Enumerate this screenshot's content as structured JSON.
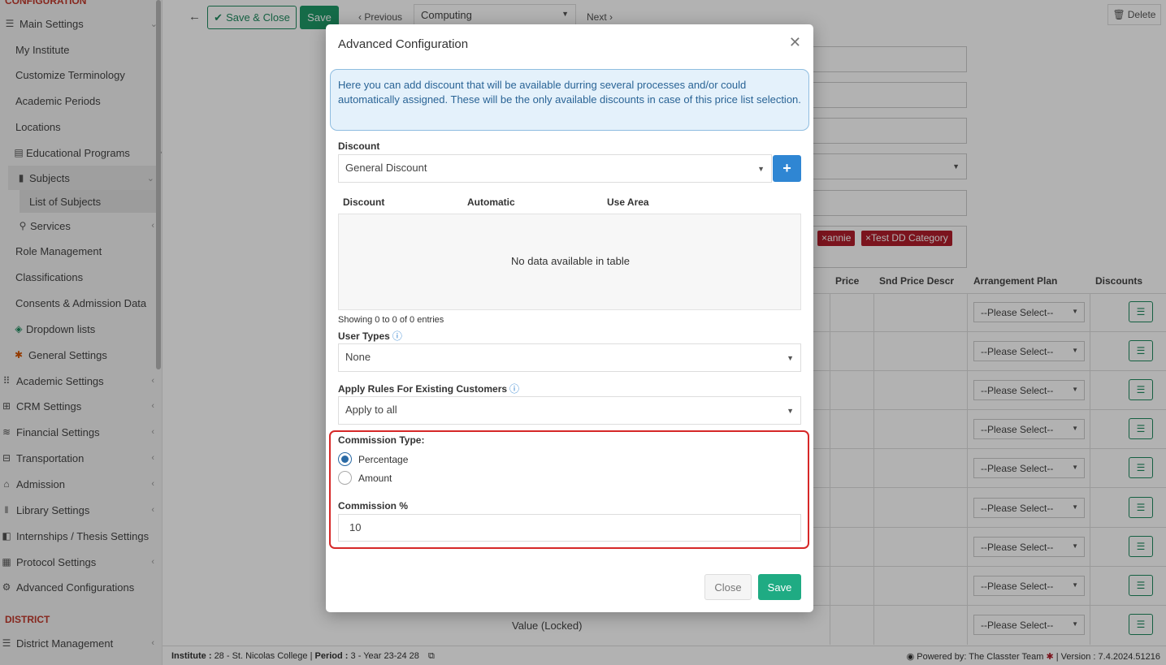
{
  "sidebar": {
    "section_config": "CONFIGURATION",
    "items": [
      {
        "label": "Main Settings",
        "icon": "sliders-icon"
      },
      {
        "label": "My Institute"
      },
      {
        "label": "Customize Terminology"
      },
      {
        "label": "Academic Periods"
      },
      {
        "label": "Locations"
      },
      {
        "label": "Educational Programs",
        "icon": "book-stack-icon"
      },
      {
        "label": "Subjects",
        "icon": "book-icon"
      },
      {
        "label": "List of Subjects"
      },
      {
        "label": "Services",
        "icon": "services-icon"
      },
      {
        "label": "Role Management"
      },
      {
        "label": "Classifications"
      },
      {
        "label": "Consents & Admission Data"
      },
      {
        "label": "Dropdown lists",
        "icon": "layers-icon"
      },
      {
        "label": "General Settings",
        "icon": "gear-icon"
      },
      {
        "label": "Academic Settings",
        "icon": "grid-icon"
      },
      {
        "label": "CRM Settings",
        "icon": "crm-icon"
      },
      {
        "label": "Financial Settings",
        "icon": "coins-icon"
      },
      {
        "label": "Transportation",
        "icon": "bus-icon"
      },
      {
        "label": "Admission",
        "icon": "building-icon"
      },
      {
        "label": "Library Settings",
        "icon": "library-icon"
      },
      {
        "label": "Internships / Thesis Settings",
        "icon": "box-icon"
      },
      {
        "label": "Protocol Settings",
        "icon": "protocol-icon"
      },
      {
        "label": "Advanced Configurations",
        "icon": "gears-icon"
      }
    ],
    "section_district": "DISTRICT",
    "district_item": "District Management"
  },
  "toolbar": {
    "save_close": "Save & Close",
    "save": "Save",
    "previous": "Previous",
    "subject_select": "Computing",
    "next": "Next",
    "delete": "Delete"
  },
  "background": {
    "tags": [
      "annie",
      "Test DD Category"
    ],
    "columns": [
      "Price",
      "Snd Price Descr",
      "Arrangement Plan",
      "Discounts"
    ],
    "row_select_value": "--Please Select--",
    "value_locked": "Value (Locked)"
  },
  "footer": {
    "institute_label": "Institute :",
    "institute_value": "28 - St. Nicolas College",
    "period_label": "Period :",
    "period_value": "3 - Year 23-24 28",
    "powered": "Powered by: The Classter Team",
    "version": "| Version : 7.4.2024.51216"
  },
  "modal": {
    "title": "Advanced Configuration",
    "info": "Here you can add discount that will be available durring several processes and/or could automatically assigned. These will be the only available discounts in case of this price list selection.",
    "discount_label": "Discount",
    "discount_value": "General Discount",
    "table_headers": [
      "Discount",
      "Automatic",
      "Use Area"
    ],
    "empty_text": "No data available in table",
    "showing": "Showing 0 to 0 of 0 entries",
    "user_types_label": "User Types",
    "user_types_value": "None",
    "apply_rules_label": "Apply Rules For Existing Customers",
    "apply_rules_value": "Apply to all",
    "commission_type_label": "Commission Type:",
    "commission_options": [
      "Percentage",
      "Amount"
    ],
    "commission_selected": "Percentage",
    "commission_pct_label": "Commission %",
    "commission_pct_value": "10",
    "close_button": "Close",
    "save_button": "Save"
  },
  "colors": {
    "accent_green": "#1f9a68",
    "accent_blue": "#2f86d3",
    "highlight_red": "#d62828",
    "tag_red": "#b01e2b"
  }
}
